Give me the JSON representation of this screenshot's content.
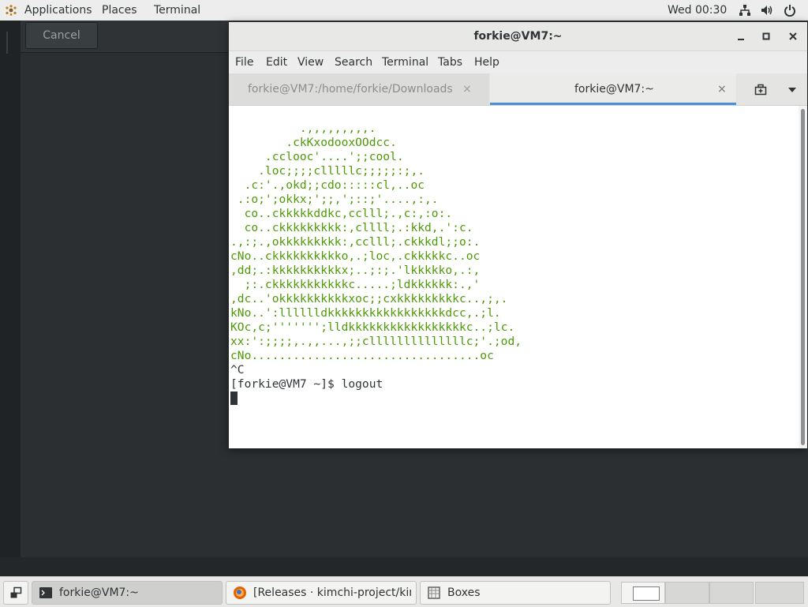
{
  "topbar": {
    "applications": "Applications",
    "places": "Places",
    "terminal": "Terminal",
    "clock": "Wed 00:30",
    "icons": [
      "network-icon",
      "volume-icon",
      "power-icon"
    ]
  },
  "background_window": {
    "cancel_label": "Cancel"
  },
  "terminal_window": {
    "title": "forkie@VM7:~",
    "menu": [
      "File",
      "Edit",
      "View",
      "Search",
      "Terminal",
      "Tabs",
      "Help"
    ],
    "tabs": [
      {
        "label": "forkie@VM7:/home/forkie/Downloads",
        "active": false
      },
      {
        "label": "forkie@VM7:~",
        "active": true
      }
    ],
    "tab_close_glyph": "×",
    "ascii_art": [
      "          .,,,,,,,,,.",
      "        .ckKxodooxOOdcc.",
      "     .cclooc'....';;cool.",
      "    .loc;;;;clllllc;;;;;:;,.",
      "  .c:'.,okd;;cdo:::::cl,..oc",
      " .:o;';okkx;';;,';::;'....,:,.",
      "  co..ckkkkkddkc,cclll;.,c:,:o:.",
      "  co..ckkkkkkkkk:,cllll;.:kkd,.':c.",
      ".,:;.,okkkkkkkkk:,cclll;.ckkkdl;;o:.",
      "cNo..ckkkkkkkkkko,.;loc,.ckkkkkc..oc",
      ",dd;.:kkkkkkkkkkx;..;:;.'lkkkkko,.:,",
      "  ;:.ckkkkkkkkkkkc.....;ldkkkkkk:.,'",
      ",dc..'okkkkkkkkkkxoc;;cxkkkkkkkkkc..,;,.",
      "kNo..':lllllldkkkkkkkkkkkkkkkkkdcc,.;l.",
      "KOc,c;''''''';lldkkkkkkkkkkkkkkkkkc..;lc.",
      "xx:':;;;;,.,,...,;;cllllllllllllllc;'.;od,",
      "cNo.................................oc"
    ],
    "lines_after": [
      "^C",
      "[forkie@VM7 ~]$ logout"
    ],
    "colors": {
      "ascii": "#4e9a06",
      "text": "#2e3436",
      "accent": "#4a90d9"
    }
  },
  "taskbar": {
    "tasks": [
      {
        "label": "forkie@VM7:~",
        "icon": "terminal-icon",
        "active": true
      },
      {
        "label": "[Releases · kimchi-project/kimch...",
        "icon": "firefox-icon",
        "active": false
      },
      {
        "label": "Boxes",
        "icon": "boxes-icon",
        "active": false
      }
    ],
    "workspaces": 4
  }
}
